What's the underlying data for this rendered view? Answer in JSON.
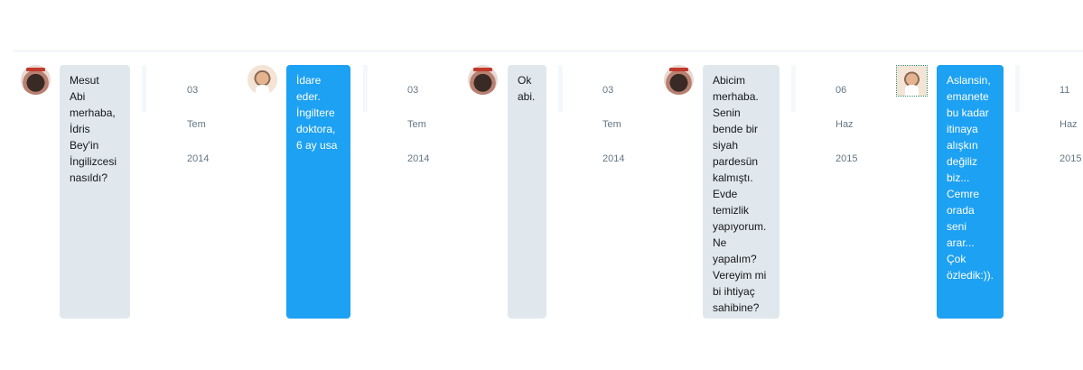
{
  "messages": [
    {
      "text": "Mesut\nAbi\nmerhaba,\nİdris\nBey'in\nİngilizcesi\nnasıldı?",
      "date": [
        "03",
        "Tem",
        "2014"
      ],
      "direction": "incoming"
    },
    {
      "text": "İdare\neder.\nİngiltere\ndoktora,\n6 ay usa",
      "date": [
        "03",
        "Tem",
        "2014"
      ],
      "direction": "outgoing"
    },
    {
      "text": "Ok\nabi.",
      "date": [
        "03",
        "Tem",
        "2014"
      ],
      "direction": "incoming"
    },
    {
      "text": "Abicim\nmerhaba.\nSenin\nbende bir\nsiyah\npardesün\nkalmıştı.\nEvde\ntemizlik\nyapıyorum.\nNe\nyapalım?\nVereyim mi\nbi ihtiyaç\nsahibine?",
      "date": [
        "06",
        "Haz",
        "2015"
      ],
      "direction": "incoming"
    },
    {
      "text": "Aslansin,\nemanete\nbu kadar\nitinaya\nalışkın\ndeğiliz\nbiz...\nCemre\norada\nseni\narar...\nÇok\nözledik:)).",
      "date": [
        "11",
        "Haz",
        "2015"
      ],
      "direction": "outgoing"
    }
  ],
  "colors": {
    "incoming_bubble": "#e1e8ed",
    "outgoing_bubble": "#1da1f2",
    "date_text": "#657786"
  }
}
